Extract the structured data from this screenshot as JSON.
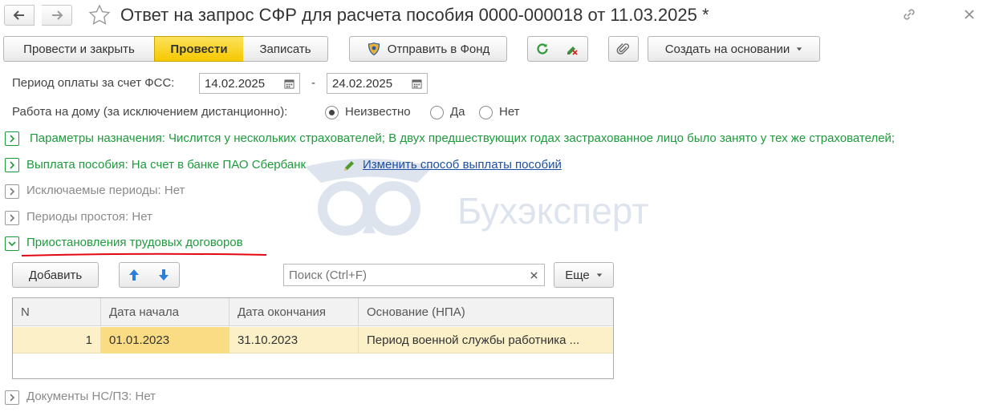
{
  "window": {
    "title": "Ответ на запрос СФР для расчета пособия 0000-000018 от 11.03.2025 *"
  },
  "toolbar": {
    "post_close": "Провести и закрыть",
    "post": "Провести",
    "save": "Записать",
    "send_fund": "Отправить в Фонд",
    "create_based": "Создать на основании"
  },
  "period": {
    "label": "Период оплаты за счет ФСС:",
    "from": "14.02.2025",
    "dash": "-",
    "to": "24.02.2025"
  },
  "homework": {
    "label": "Работа на дому (за исключением дистанционно):",
    "options": [
      "Неизвестно",
      "Да",
      "Нет"
    ],
    "selected": "Неизвестно"
  },
  "sections": {
    "params": "Параметры назначения: Числится у нескольких страхователей; В двух предшествующих годах застрахованное лицо было занято у тех же страхователей;",
    "payment": "Выплата пособия: На счет в банке ПАО Сбербанк",
    "payment_link": "Изменить способ выплаты пособий",
    "excluded": "Исключаемые периоды: Нет",
    "downtime": "Периоды простоя: Нет",
    "suspension": "Приостановления трудовых договоров",
    "documents": "Документы НС/ПЗ: Нет"
  },
  "table_toolbar": {
    "add": "Добавить",
    "search_placeholder": "Поиск (Ctrl+F)",
    "more": "Еще"
  },
  "table": {
    "columns": [
      "N",
      "Дата начала",
      "Дата окончания",
      "Основание (НПА)"
    ],
    "rows": [
      {
        "n": "1",
        "start": "01.01.2023",
        "end": "31.10.2023",
        "basis": "Период военной службы работника ..."
      }
    ]
  },
  "watermark": "Бухэксперт",
  "colors": {
    "accent_green": "#1e9a3c",
    "primary_button": "#f6c800",
    "selected_row": "#fbf0c8",
    "underline_red": "#e30613"
  }
}
